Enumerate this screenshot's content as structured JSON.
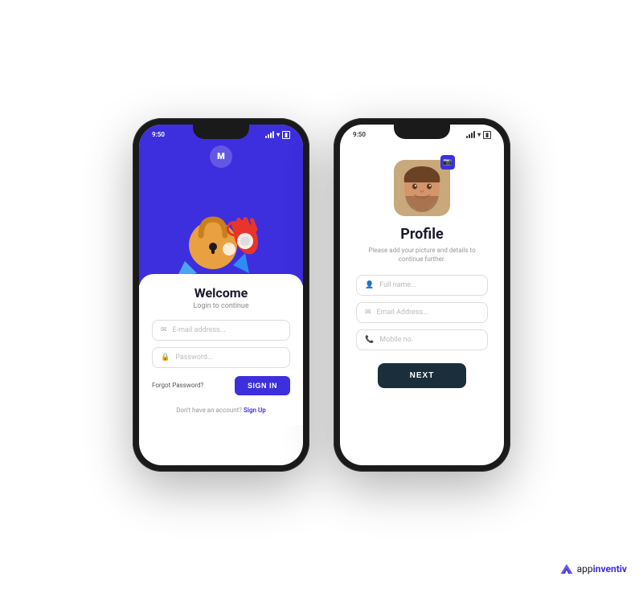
{
  "phones": {
    "phone1": {
      "status_time": "9:50",
      "header_bg": "#3d2ede",
      "logo_letter": "M",
      "welcome_title": "Welcome",
      "welcome_subtitle": "Login to continue",
      "email_placeholder": "E-mail address...",
      "password_placeholder": "Password...",
      "forgot_password_label": "Forgot Password?",
      "sign_in_label": "SIGN IN",
      "no_account_text": "Don't have an account?",
      "sign_up_label": "Sign Up"
    },
    "phone2": {
      "status_time": "9:50",
      "profile_title": "Profile",
      "profile_subtitle": "Please add your picture and details\nto continue further.",
      "fullname_placeholder": "Full name...",
      "email_placeholder": "Email Address...",
      "mobile_placeholder": "Mobile no.",
      "next_label": "NEXT"
    }
  },
  "brand": {
    "name": "appinventiv",
    "name_styled": "app",
    "name_accent": "inventiv"
  }
}
